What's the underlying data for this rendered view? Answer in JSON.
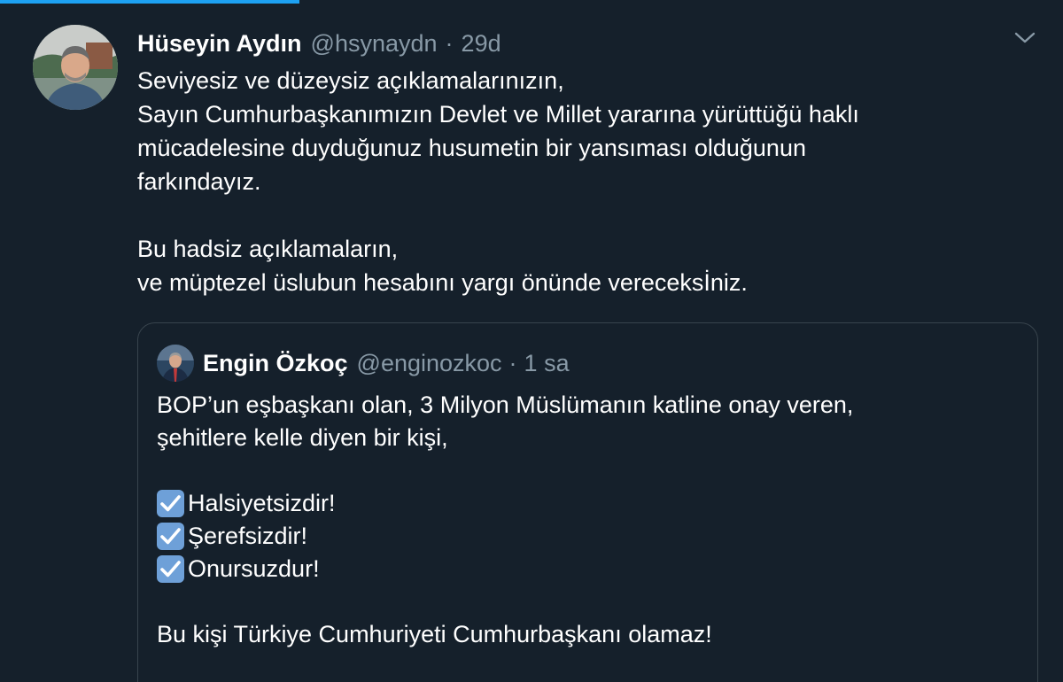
{
  "tweet": {
    "author_name": "Hüseyin Aydın",
    "author_handle": "@hsynaydn",
    "separator": "·",
    "time": "29d",
    "text_lines": [
      "Seviyesiz ve düzeysiz açıklamalarınızın,",
      "Sayın Cumhurbaşkanımızın Devlet ve Millet yararına yürüttüğü haklı",
      "mücadelesine duyduğunuz husumetin bir yansıması olduğunun",
      "farkındayız.",
      "Bu hadsiz açıklamaların,",
      "ve müptezel üslubun hesabını yargı önünde vereceksİniz."
    ]
  },
  "quote": {
    "author_name": "Engin Özkoç",
    "author_handle": "@enginozkoc",
    "separator": "·",
    "time": "1 sa",
    "text_lines": [
      "BOP’un eşbaşkanı olan, 3 Milyon Müslümanın katline onay veren,",
      "şehitlere kelle diyen bir kişi,"
    ],
    "checklist": [
      "Halsiyetsizdir!",
      "Şerefsizdir!",
      "Onursuzdur!"
    ],
    "closing": "Bu kişi Türkiye Cumhuriyeti Cumhurbaşkanı olamaz!"
  },
  "icons": {
    "menu": "chevron-down-icon",
    "check": "check-mark-button-icon"
  },
  "colors": {
    "background": "#15202b",
    "accent": "#1da1f2",
    "secondary_text": "#8899a6",
    "border": "#38444d"
  }
}
